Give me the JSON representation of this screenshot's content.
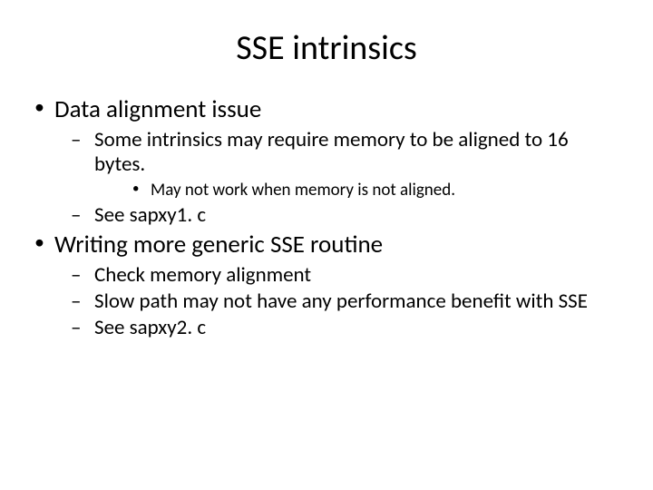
{
  "title": "SSE intrinsics",
  "bullets": {
    "b1": "Data alignment issue",
    "b1_1": "Some intrinsics may require memory to be aligned to 16 bytes.",
    "b1_1_1": "May not work when memory is not aligned.",
    "b1_2": "See sapxy1. c",
    "b2": "Writing more generic SSE routine",
    "b2_1": "Check memory alignment",
    "b2_2": "Slow path may not have any performance benefit with SSE",
    "b2_3": " See sapxy2. c"
  }
}
